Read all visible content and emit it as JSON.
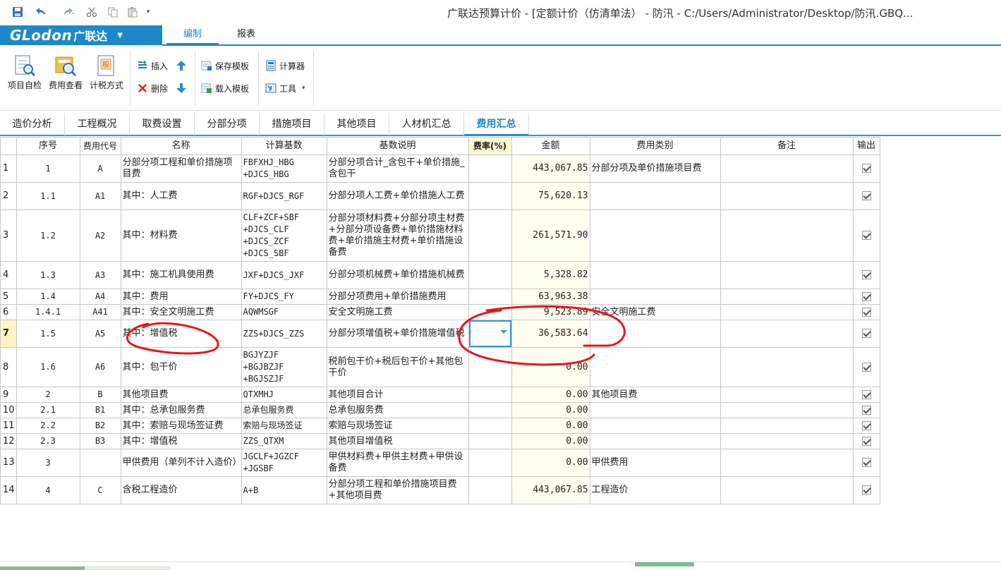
{
  "window": {
    "title": "广联达预算计价 - [定额计价（仿清单法） - 防汛 - C:/Users/Administrator/Desktop/防汛.GBQ..."
  },
  "brand": {
    "logo": "GLodon",
    "name": "广联达"
  },
  "ribbon_tabs": [
    {
      "label": "编制",
      "active": true
    },
    {
      "label": "报表",
      "active": false
    }
  ],
  "toolbar": {
    "self_check": "项目自检",
    "fee_view": "费用查看",
    "tax_method": "计税方式",
    "insert": "插入",
    "delete": "删除",
    "save_template": "保存模板",
    "load_template": "载入模板",
    "calculator": "计算器",
    "tools": "工具"
  },
  "nav_tabs": [
    {
      "label": "造价分析"
    },
    {
      "label": "工程概况"
    },
    {
      "label": "取费设置"
    },
    {
      "label": "分部分项"
    },
    {
      "label": "措施项目"
    },
    {
      "label": "其他项目"
    },
    {
      "label": "人材机汇总"
    },
    {
      "label": "费用汇总",
      "active": true
    }
  ],
  "columns": {
    "seq": "序号",
    "code": "费用代号",
    "name": "名称",
    "base": "计算基数",
    "desc": "基数说明",
    "rate": "费率(%)",
    "amount": "金额",
    "category": "费用类别",
    "note": "备注",
    "output": "输出"
  },
  "rows": [
    {
      "rn": "1",
      "seq": "1",
      "code": "A",
      "name": "分部分项工程和单价措施项目费",
      "base": "FBFXHJ_HBG\n+DJCS_HBG",
      "desc": "分部分项合计_含包干+单价措施_含包干",
      "rate": "",
      "amount": "443,067.85",
      "category": "分部分项及单价措施项目费",
      "note": "",
      "output": true
    },
    {
      "rn": "2",
      "seq": "1.1",
      "code": "A1",
      "name": "其中：人工费",
      "base": "RGF+DJCS_RGF",
      "desc": "分部分项人工费+单价措施人工费",
      "rate": "",
      "amount": "75,620.13",
      "category": "",
      "note": "",
      "output": true
    },
    {
      "rn": "3",
      "seq": "1.2",
      "code": "A2",
      "name": "其中：材料费",
      "base": "CLF+ZCF+SBF\n+DJCS_CLF\n+DJCS_ZCF\n+DJCS_SBF",
      "desc": "分部分项材料费+分部分项主材费+分部分项设备费+单价措施材料费+单价措施主材费+单价措施设备费",
      "rate": "",
      "amount": "261,571.90",
      "category": "",
      "note": "",
      "output": true
    },
    {
      "rn": "4",
      "seq": "1.3",
      "code": "A3",
      "name": "其中：施工机具使用费",
      "base": "JXF+DJCS_JXF",
      "desc": "分部分项机械费+单价措施机械费",
      "rate": "",
      "amount": "5,328.82",
      "category": "",
      "note": "",
      "output": true
    },
    {
      "rn": "5",
      "seq": "1.4",
      "code": "A4",
      "name": "其中：费用",
      "base": "FY+DJCS_FY",
      "desc": "分部分项费用+单价措施费用",
      "rate": "",
      "amount": "63,963.38",
      "category": "",
      "note": "",
      "output": true
    },
    {
      "rn": "6",
      "seq": "1.4.1",
      "code": "A41",
      "name": "其中：安全文明施工费",
      "base": "AQWMSGF",
      "desc": "安全文明施工费",
      "rate": "",
      "amount": "9,523.89",
      "category": "安全文明施工费",
      "note": "",
      "output": true
    },
    {
      "rn": "7",
      "seq": "1.5",
      "code": "A5",
      "name": "其中：增值税",
      "base": "ZZS+DJCS_ZZS",
      "desc": "分部分项增值税+单价措施增值税",
      "rate": "",
      "amount": "36,583.64",
      "category": "",
      "note": "",
      "output": true
    },
    {
      "rn": "8",
      "seq": "1.6",
      "code": "A6",
      "name": "其中：包干价",
      "base": "BGJYZJF\n+BGJBZJF\n+BGJSZJF",
      "desc": "税前包干价+税后包干价+其他包干价",
      "rate": "",
      "amount": "0.00",
      "category": "",
      "note": "",
      "output": true
    },
    {
      "rn": "9",
      "seq": "2",
      "code": "B",
      "name": "其他项目费",
      "base": "QTXMHJ",
      "desc": "其他项目合计",
      "rate": "",
      "amount": "0.00",
      "category": "其他项目费",
      "note": "",
      "output": true
    },
    {
      "rn": "10",
      "seq": "2.1",
      "code": "B1",
      "name": "其中：总承包服务费",
      "base": "总承包服务费",
      "desc": "总承包服务费",
      "rate": "",
      "amount": "0.00",
      "category": "",
      "note": "",
      "output": true
    },
    {
      "rn": "11",
      "seq": "2.2",
      "code": "B2",
      "name": "其中：索赔与现场签证费",
      "base": "索赔与现场签证",
      "desc": "索赔与现场签证",
      "rate": "",
      "amount": "0.00",
      "category": "",
      "note": "",
      "output": true
    },
    {
      "rn": "12",
      "seq": "2.3",
      "code": "B3",
      "name": "其中：增值税",
      "base": "ZZS_QTXM",
      "desc": "其他项目增值税",
      "rate": "",
      "amount": "0.00",
      "category": "",
      "note": "",
      "output": true
    },
    {
      "rn": "13",
      "seq": "3",
      "code": "",
      "name": "甲供费用（单列不计入造价）",
      "base": "JGCLF+JGZCF\n+JGSBF",
      "desc": "甲供材料费+甲供主材费+甲供设备费",
      "rate": "",
      "amount": "0.00",
      "category": "甲供费用",
      "note": "",
      "output": true
    },
    {
      "rn": "14",
      "seq": "4",
      "code": "C",
      "name": "含税工程造价",
      "base": "A+B",
      "desc": "分部分项工程和单价措施项目费+其他项目费",
      "rate": "",
      "amount": "443,067.85",
      "category": "工程造价",
      "note": "",
      "output": true
    }
  ],
  "selected_row": 6,
  "colors": {
    "accent": "#1e88c9",
    "annotation": "#e8161b",
    "amount_bg": "#fffdf0"
  }
}
